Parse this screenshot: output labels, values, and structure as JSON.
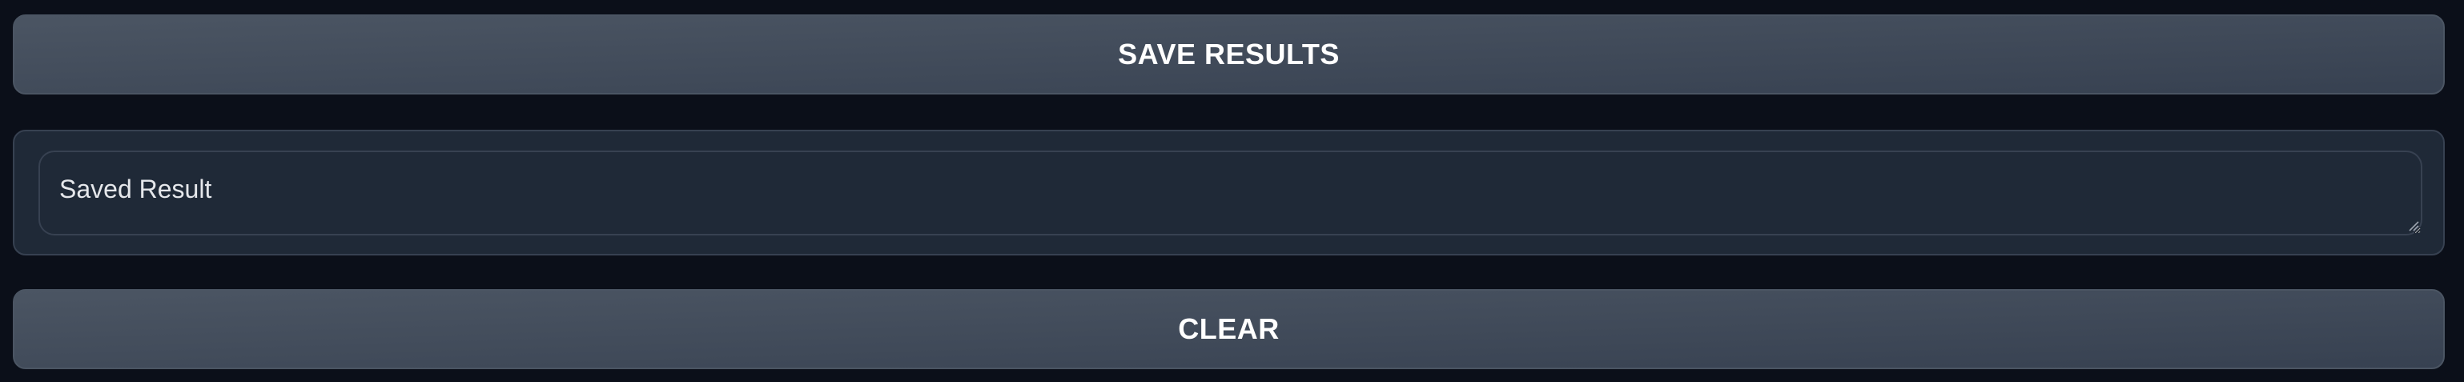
{
  "buttons": {
    "save_label": "SAVE RESULTS",
    "clear_label": "CLEAR"
  },
  "saved_result": {
    "value": "Saved Result"
  },
  "colors": {
    "background": "#0b0f19",
    "button_bg": "#4b5563",
    "panel_bg": "#1f2937",
    "border": "#374151",
    "text": "#ffffff"
  },
  "icons": {
    "resize_grip": "resize-grip-icon"
  }
}
